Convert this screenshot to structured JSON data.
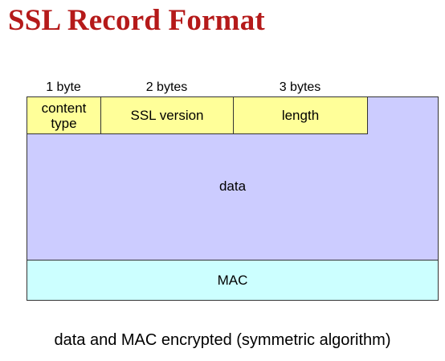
{
  "title": "SSL Record Format",
  "header_fields": [
    {
      "size": "1 byte",
      "label_line1": "content",
      "label_line2": "type"
    },
    {
      "size": "2 bytes",
      "label": "SSL version"
    },
    {
      "size": "3 bytes",
      "label": "length"
    }
  ],
  "data_label": "data",
  "mac_label": "MAC",
  "caption": "data and MAC encrypted (symmetric algorithm)",
  "colors": {
    "title": "#b51a1a",
    "header_fill": "#ffff99",
    "data_fill": "#ccccff",
    "mac_fill": "#ccffff"
  }
}
